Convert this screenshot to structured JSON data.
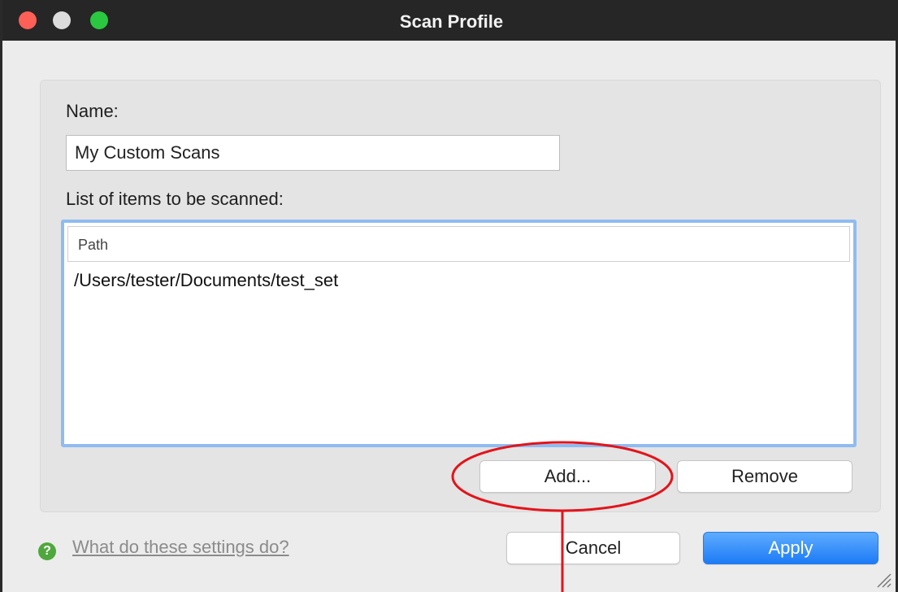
{
  "window": {
    "title": "Scan Profile"
  },
  "form": {
    "name_label": "Name:",
    "name_value": "My Custom Scans",
    "list_label": "List of items to be scanned:",
    "column_header": "Path",
    "rows": [
      "/Users/tester/Documents/test_set"
    ]
  },
  "buttons": {
    "add": "Add...",
    "remove": "Remove",
    "cancel": "Cancel",
    "apply": "Apply"
  },
  "help": {
    "link_text": "What do these settings do?",
    "icon": "help-question-icon"
  },
  "colors": {
    "accent": "#1d7bf5",
    "highlight_annotation": "#e3141b",
    "focus_ring": "#8fbcf0"
  }
}
